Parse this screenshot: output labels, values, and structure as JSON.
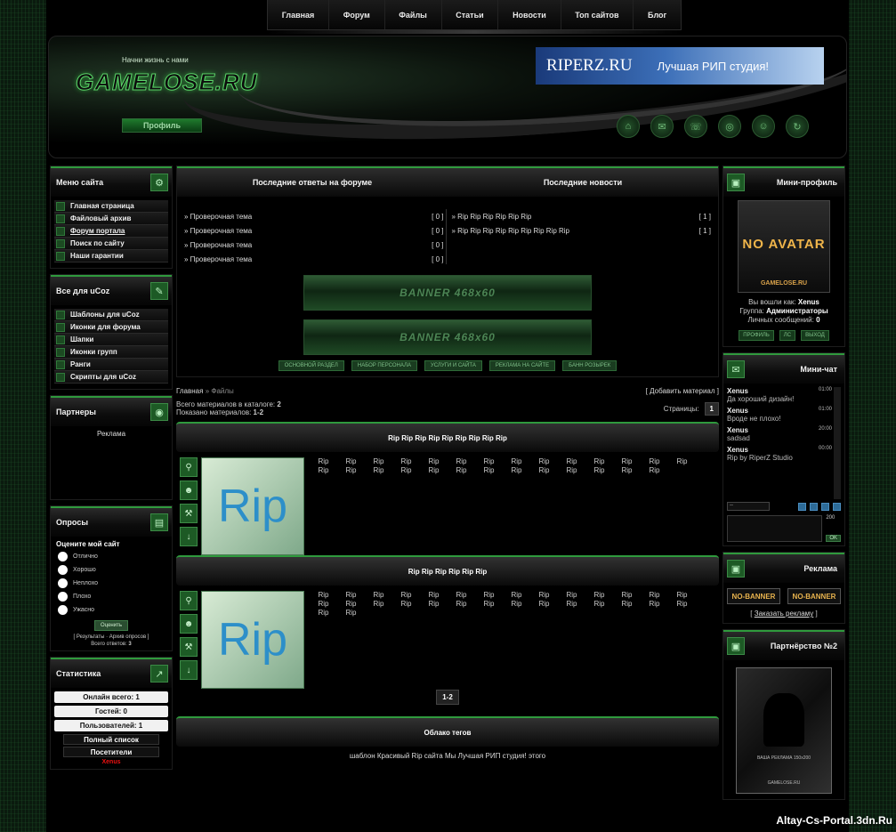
{
  "nav": [
    "Главная",
    "Форум",
    "Файлы",
    "Статьи",
    "Новости",
    "Топ сайтов",
    "Блог"
  ],
  "header": {
    "slogan": "Начни жизнь с нами",
    "logo": "GAMELOSE.RU",
    "profile_button": "Профиль",
    "banner_name": "RIPERZ.RU",
    "banner_tagline": "Лучшая РИП студия!",
    "icons": [
      "home-icon",
      "chat-icon",
      "phone-icon",
      "globe-icon",
      "users-icon",
      "refresh-icon"
    ]
  },
  "left": {
    "menu_title": "Меню сайта",
    "menu_items": [
      "Главная страница",
      "Файловый архив",
      "Форум портала",
      "Поиск по сайту",
      "Наши гарантии"
    ],
    "ucoz_title": "Все для uCoz",
    "ucoz_items": [
      "Шаблоны для uCoz",
      "Иконки для форума",
      "Шапки",
      "Иконки групп",
      "Ранги",
      "Скрипты для uCoz"
    ],
    "partners_title": "Партнеры",
    "partners_text": "Реклама",
    "poll_title": "Опросы",
    "poll_question": "Оцените мой сайт",
    "poll_options": [
      "Отлично",
      "Хорошо",
      "Неплохо",
      "Плохо",
      "Ужасно"
    ],
    "poll_vote": "Оценить",
    "poll_results": "Результаты",
    "poll_archive": "Архив опросов",
    "poll_total": "Всего ответов:",
    "poll_total_value": "3",
    "stats_title": "Статистика",
    "stats_online": "Онлайн всего: 1",
    "stats_guests": "Гостей: 0",
    "stats_users": "Пользователей: 1",
    "stats_full": "Полный список",
    "stats_visitors": "Посетители",
    "stats_user": "Xenus"
  },
  "main": {
    "forum_title": "Последние ответы на форуме",
    "news_title": "Последние новости",
    "forum_rows": [
      {
        "title": "Проверочная тема",
        "count": "[ 0 ]"
      },
      {
        "title": "Проверочная тема",
        "count": "[ 0 ]"
      },
      {
        "title": "Проверочная тема",
        "count": "[ 0 ]"
      },
      {
        "title": "Проверочная тема",
        "count": "[ 0 ]"
      }
    ],
    "news_rows": [
      {
        "title": "Rip Rip Rip Rip Rip Rip",
        "count": "[ 1 ]"
      },
      {
        "title": "Rip Rip Rip Rip Rip Rip Rip Rip Rip",
        "count": "[ 1 ]"
      }
    ],
    "banner1": "BANNER 468x60",
    "banner2": "BANNER 468x60",
    "mini_buttons": [
      "ОСНОВНОЙ РАЗДЕЛ",
      "НАБОР ПЕРСОНАЛА",
      "УСЛУГИ И САЙТА",
      "РЕКЛАМА НА САЙТЕ",
      "БАНН РОЗЫРЕК"
    ],
    "breadcrumb_home": "Главная",
    "breadcrumb_sep": "»",
    "breadcrumb_current": "Файлы",
    "add_material": "[ Добавить материал ]",
    "total_label": "Всего материалов в каталоге:",
    "total_value": "2",
    "shown_label": "Показано материалов:",
    "shown_value": "1-2",
    "pages_label": "Страницы:",
    "pages_value": "1",
    "entries": [
      {
        "title": "Rip Rip Rip Rip Rip Rip Rip Rip Rip",
        "thumb": "Rip",
        "rip_count": 27
      },
      {
        "title": "Rip Rip Rip Rip Rip Rip",
        "thumb": "Rip",
        "rip_count": 30
      }
    ],
    "rip_word": "Rip",
    "pager": "1-2",
    "tags_title": "Облако тегов",
    "tags_text": "шаблон Красивый Rip сайта Мы Лучшая РИП студия! этого"
  },
  "right": {
    "mini_title": "Мини-профиль",
    "no_avatar": "NO AVATAR",
    "avatar_site": "GAMELOSE.RU",
    "logged_label": "Вы вошли как:",
    "logged_user": "Xenus",
    "group_label": "Группа:",
    "group_value": "Администраторы",
    "pm_label": "Личных сообщений:",
    "pm_value": "0",
    "btn_profile": "ПРОФИЛЬ",
    "btn_pm": "ЛС",
    "btn_exit": "ВЫХОД",
    "chat_title": "Мини-чат",
    "chat": [
      {
        "user": "Xenus",
        "time": "01:00",
        "text": "Да хороший дизайн!"
      },
      {
        "user": "Xenus",
        "time": "01:00",
        "text": "Вроде не плохо!"
      },
      {
        "user": "Xenus",
        "time": "20:00",
        "text": "sadsad"
      },
      {
        "user": "Xenus",
        "time": "00:00",
        "text": "Rip by RiperZ Studio"
      }
    ],
    "chat_select": "--",
    "chat_limit": "200",
    "chat_ok": "OK",
    "ad_title": "Реклама",
    "no_banner": "NO-BANNER",
    "order_ad": "Заказать рекламу",
    "partner2_title": "Партнёрство №2",
    "partner2_line1": "ВАША РЕКЛАМА 150x200",
    "partner2_line2": "GAMELOSE.RU"
  },
  "watermark": "Altay-Cs-Portal.3dn.Ru"
}
